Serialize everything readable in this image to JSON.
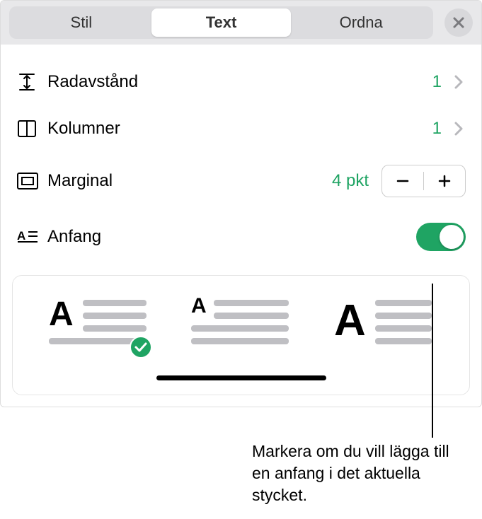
{
  "tabs": {
    "style": "Stil",
    "text": "Text",
    "arrange": "Ordna"
  },
  "rows": {
    "lineSpacing": {
      "label": "Radavstånd",
      "value": "1"
    },
    "columns": {
      "label": "Kolumner",
      "value": "1"
    },
    "margin": {
      "label": "Marginal",
      "value": "4 pkt"
    },
    "dropCap": {
      "label": "Anfang"
    }
  },
  "callout": "Markera om du vill lägga till en anfang i det aktuella stycket.",
  "colors": {
    "accent": "#1fa463"
  }
}
